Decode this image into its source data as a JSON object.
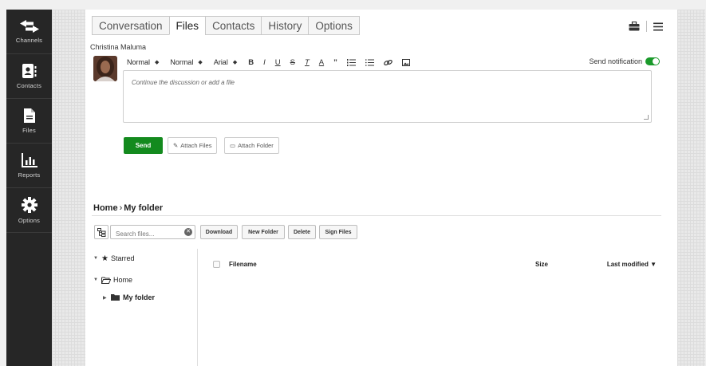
{
  "sidebar": {
    "items": [
      {
        "label": "Channels",
        "icon": "channels-arrows-icon"
      },
      {
        "label": "Contacts",
        "icon": "contact-card-icon"
      },
      {
        "label": "Files",
        "icon": "file-icon"
      },
      {
        "label": "Reports",
        "icon": "bar-chart-icon"
      },
      {
        "label": "Options",
        "icon": "gear-icon"
      }
    ]
  },
  "tabs": [
    {
      "label": "Conversation",
      "active": false
    },
    {
      "label": "Files",
      "active": true
    },
    {
      "label": "Contacts",
      "active": false
    },
    {
      "label": "History",
      "active": false
    },
    {
      "label": "Options",
      "active": false
    }
  ],
  "header_icons": [
    "toolbox-icon",
    "hamburger-menu-icon"
  ],
  "composer": {
    "author": "Christina Maluma",
    "toolbar": {
      "style_select": "Normal",
      "size_select": "Normal",
      "font_select": "Arial",
      "format_buttons": [
        "bold",
        "italic",
        "underline",
        "strikethrough",
        "clear-format",
        "text-color",
        "blockquote",
        "ordered-list",
        "bullet-list",
        "link",
        "image"
      ]
    },
    "send_notification_label": "Send notification",
    "send_notification_on": true,
    "placeholder": "Continue the discussion or add a file",
    "send_label": "Send",
    "attach_files_label": "Attach Files",
    "attach_folder_label": "Attach Folder"
  },
  "files": {
    "breadcrumb_home": "Home",
    "breadcrumb_sep": "›",
    "breadcrumb_current": "My folder",
    "search_placeholder": "Search files...",
    "buttons": {
      "download": "Download",
      "new_folder": "New Folder",
      "delete": "Delete",
      "sign_files": "Sign Files"
    },
    "tree": {
      "starred": "Starred",
      "home": "Home",
      "my_folder": "My folder"
    },
    "columns": {
      "filename": "Filename",
      "size": "Size",
      "last_modified": "Last modified ▼"
    }
  },
  "colors": {
    "sidebar_bg": "#262626",
    "send_green": "#138a1e",
    "toggle_green": "#1a9a2a"
  }
}
